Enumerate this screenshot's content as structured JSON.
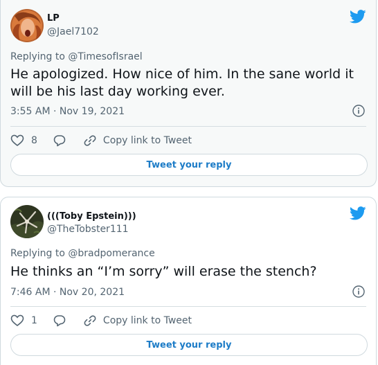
{
  "tweets": [
    {
      "name": "LP",
      "handle": "@Jael7102",
      "replying_to": "Replying to @TimesofIsrael",
      "text": "He apologized. How nice of him. In the sane world it will be his last day working ever.",
      "timestamp": "3:55 AM · Nov 19, 2021",
      "like_count": "8",
      "copy_link_label": "Copy link to Tweet",
      "reply_button_label": "Tweet your reply"
    },
    {
      "name": "(((Toby Epstein)))",
      "handle": "@TheTobster111",
      "replying_to": "Replying to @bradpomerance",
      "text": "He thinks an “I’m sorry” will erase the stench?",
      "timestamp": "7:46 AM · Nov 20, 2021",
      "like_count": "1",
      "copy_link_label": "Copy link to Tweet",
      "reply_button_label": "Tweet your reply"
    }
  ],
  "icons": {
    "brand": "twitter-bird-icon",
    "like": "heart-icon",
    "reply": "comment-bubble-icon",
    "copy": "link-icon",
    "info": "info-icon"
  },
  "colors": {
    "brand_blue": "#1d9bf0",
    "reply_text_blue": "#1d7cc7",
    "secondary_text": "#536471",
    "border": "#cfd9de"
  }
}
